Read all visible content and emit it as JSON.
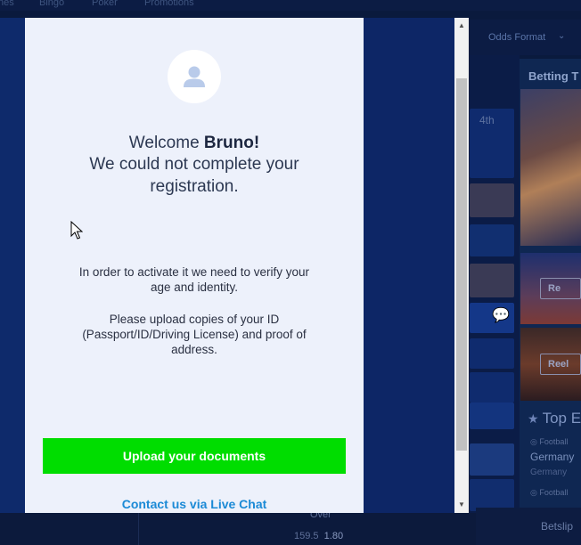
{
  "site": {
    "top_nav": [
      "nes",
      "Bingo",
      "Poker",
      "Promotions"
    ],
    "odds_format_label": "Odds Format",
    "week_label": "4th",
    "promo_title": "Betting T",
    "promo_buttons": [
      "Re",
      "Reel"
    ],
    "top_events_title": "Top E",
    "events": [
      {
        "sport": "Football",
        "team": "Germany",
        "sub": "Germany"
      },
      {
        "sport": "Football",
        "team": "",
        "sub": ""
      }
    ],
    "over_label": "Over",
    "odds_line": "159.5",
    "odds_value": "1.80",
    "betslip_label": "Betslip"
  },
  "modal": {
    "welcome_prefix": "Welcome",
    "user_name": "Bruno!",
    "message_lines": [
      "We could not complete your",
      "registration."
    ],
    "verify_lines": [
      "In order to activate it we need to verify your",
      "age and identity."
    ],
    "upload_lines": [
      "Please upload copies of your ID",
      "(Passport/ID/Driving License) and proof of",
      "address."
    ],
    "upload_button": "Upload your documents",
    "live_chat_link": "Contact us via Live Chat",
    "accent_green": "#00dd00",
    "link_blue": "#1b8ad6"
  },
  "icons": {
    "avatar": "user-icon",
    "scroll_up": "arrow-up-icon",
    "scroll_down": "arrow-down-icon",
    "cursor": "mouse-pointer-icon"
  }
}
